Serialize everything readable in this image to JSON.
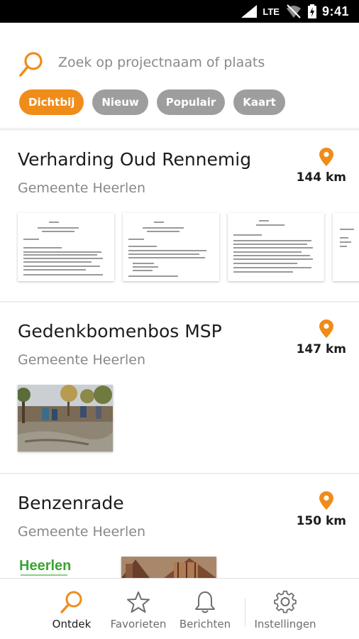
{
  "status_bar": {
    "network": "LTE",
    "time": "9:41"
  },
  "search": {
    "placeholder": "Zoek op projectnaam of plaats"
  },
  "filters": [
    {
      "label": "Dichtbij",
      "active": true
    },
    {
      "label": "Nieuw",
      "active": false
    },
    {
      "label": "Populair",
      "active": false
    },
    {
      "label": "Kaart",
      "active": false
    }
  ],
  "projects": [
    {
      "title": "Verharding Oud Rennemig",
      "subtitle": "Gemeente Heerlen",
      "distance": "144 km",
      "media": "documents"
    },
    {
      "title": "Gedenkbomenbos MSP",
      "subtitle": "Gemeente Heerlen",
      "distance": "147 km",
      "media": "photo"
    },
    {
      "title": "Benzenrade",
      "subtitle": "Gemeente Heerlen",
      "distance": "150 km",
      "media": "logo-and-photo",
      "logo_text": "Heerlen"
    }
  ],
  "bottom_nav": [
    {
      "label": "Ontdek",
      "icon": "search-icon",
      "active": true
    },
    {
      "label": "Favorieten",
      "icon": "star-icon",
      "active": false
    },
    {
      "label": "Berichten",
      "icon": "bell-icon",
      "active": false
    },
    {
      "label": "Instellingen",
      "icon": "gear-icon",
      "active": false
    }
  ],
  "colors": {
    "accent": "#f08c1a",
    "chip_inactive": "#9e9e9e",
    "logo_green": "#3aa335"
  }
}
